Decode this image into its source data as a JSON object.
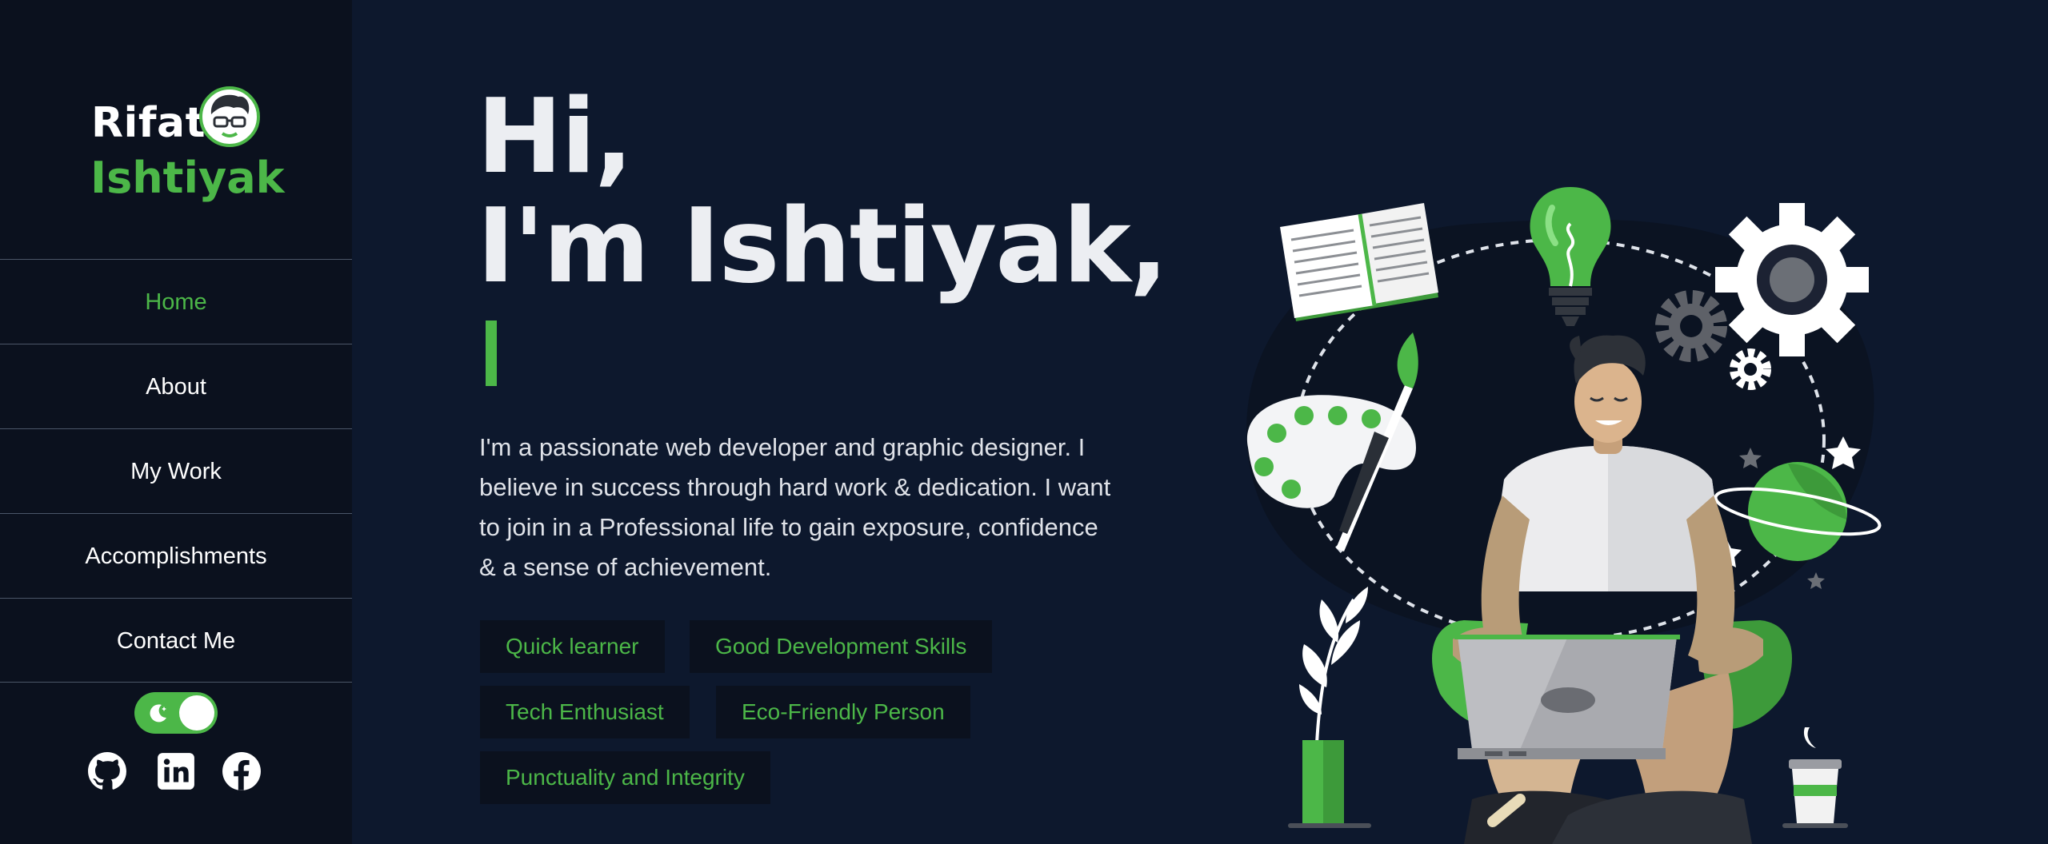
{
  "logo": {
    "first": "Rifat",
    "last": "Ishtiyak",
    "avatar_icon": "avatar-glasses-icon"
  },
  "nav": {
    "items": [
      {
        "label": "Home",
        "active": true
      },
      {
        "label": "About",
        "active": false
      },
      {
        "label": "My Work",
        "active": false
      },
      {
        "label": "Accomplishments",
        "active": false
      },
      {
        "label": "Contact Me",
        "active": false
      }
    ]
  },
  "theme_toggle": {
    "icon": "moon-icon",
    "state": "dark"
  },
  "social": [
    {
      "icon": "github-icon"
    },
    {
      "icon": "linkedin-icon"
    },
    {
      "icon": "facebook-icon"
    }
  ],
  "hero": {
    "greeting": "Hi,",
    "name_line": "I'm Ishtiyak,",
    "intro": "I'm a passionate web developer and graphic designer. I believe in success through hard work & dedication. I want to join in a Professional life to gain exposure, confidence & a sense of achievement."
  },
  "chips": [
    "Quick learner",
    "Good Development Skills",
    "Tech Enthusiast",
    "Eco-Friendly Person",
    "Punctuality and Integrity"
  ],
  "colors": {
    "background": "#0d182d",
    "sidebar": "#0b111e",
    "accent": "#4cb748",
    "text": "#eceef2"
  }
}
